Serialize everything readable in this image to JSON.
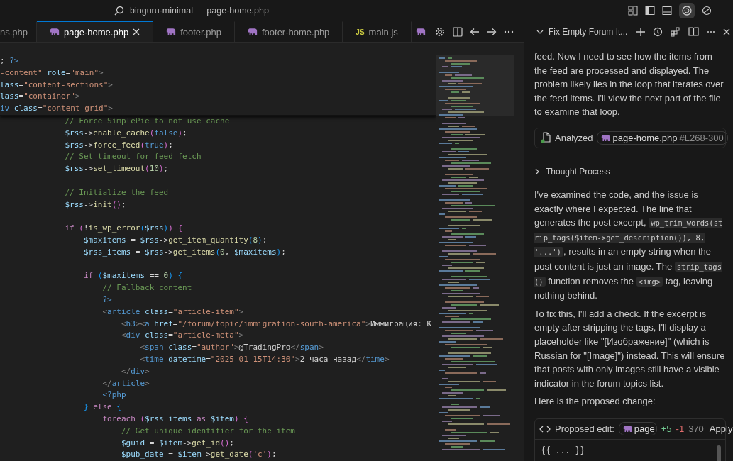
{
  "title_bar": {
    "title": "binguru-minimal — page-home.php"
  },
  "editor": {
    "tabs": [
      {
        "label": "ns.php",
        "selected": false,
        "kind": "cut"
      },
      {
        "label": "page-home.php",
        "selected": true,
        "kind": "php"
      },
      {
        "label": "footer.php",
        "selected": false,
        "kind": "php"
      },
      {
        "label": "footer-home.php",
        "selected": false,
        "kind": "php"
      },
      {
        "label": "main.js",
        "selected": false,
        "kind": "js",
        "badge": "JS"
      },
      {
        "selected": false,
        "kind": "php"
      }
    ],
    "sticky_lines": [
      {
        "kind": "code",
        "tokens": [
          {
            "text": "; ",
            "kind": "p"
          },
          {
            "text": "?>",
            "kind": "x"
          }
        ]
      },
      {
        "kind": "code",
        "tokens": [
          {
            "text": "-content\"",
            "kind": "s"
          },
          {
            "text": " role",
            "kind": "a"
          },
          {
            "text": "=",
            "kind": "p"
          },
          {
            "text": "\"main\"",
            "kind": "s"
          },
          {
            "text": ">",
            "kind": "g"
          }
        ]
      },
      {
        "kind": "code",
        "tokens": [
          {
            "text": "lass",
            "kind": "a"
          },
          {
            "text": "=",
            "kind": "p"
          },
          {
            "text": "\"content-sections\"",
            "kind": "s"
          },
          {
            "text": ">",
            "kind": "g"
          }
        ]
      },
      {
        "kind": "code",
        "tokens": [
          {
            "text": "lass",
            "kind": "a"
          },
          {
            "text": "=",
            "kind": "p"
          },
          {
            "text": "\"container\"",
            "kind": "s"
          },
          {
            "text": ">",
            "kind": "g"
          }
        ]
      },
      {
        "kind": "code",
        "tokens": [
          {
            "text": "iv",
            "kind": "t"
          },
          {
            "text": " class",
            "kind": "a"
          },
          {
            "text": "=",
            "kind": "p"
          },
          {
            "text": "\"content-grid\"",
            "kind": "s"
          },
          {
            "text": ">",
            "kind": "g"
          }
        ]
      }
    ],
    "lines": [
      {
        "kind": "code",
        "tokens": [
          {
            "text": "            // Force SimplePie to not use cache",
            "kind": "c"
          }
        ]
      },
      {
        "kind": "code",
        "tokens": [
          {
            "text": "            $rss",
            "kind": "v"
          },
          {
            "text": "->",
            "kind": "p"
          },
          {
            "text": "enable_cache",
            "kind": "f"
          },
          {
            "text": "(",
            "kind": "y"
          },
          {
            "text": "false",
            "kind": "l"
          },
          {
            "text": ")",
            "kind": "y"
          },
          {
            "text": ";",
            "kind": "p"
          }
        ]
      },
      {
        "kind": "code",
        "tokens": [
          {
            "text": "            $rss",
            "kind": "v"
          },
          {
            "text": "->",
            "kind": "p"
          },
          {
            "text": "force_feed",
            "kind": "f"
          },
          {
            "text": "(",
            "kind": "y"
          },
          {
            "text": "true",
            "kind": "l"
          },
          {
            "text": ")",
            "kind": "y"
          },
          {
            "text": ";",
            "kind": "p"
          }
        ]
      },
      {
        "kind": "code",
        "tokens": [
          {
            "text": "            // Set timeout for feed fetch",
            "kind": "c"
          }
        ]
      },
      {
        "kind": "code",
        "tokens": [
          {
            "text": "            $rss",
            "kind": "v"
          },
          {
            "text": "->",
            "kind": "p"
          },
          {
            "text": "set_timeout",
            "kind": "f"
          },
          {
            "text": "(",
            "kind": "y"
          },
          {
            "text": "10",
            "kind": "n"
          },
          {
            "text": ")",
            "kind": "y"
          },
          {
            "text": ";",
            "kind": "p"
          }
        ]
      },
      {
        "kind": "blank"
      },
      {
        "kind": "code",
        "tokens": [
          {
            "text": "            // Initialize the feed",
            "kind": "c"
          }
        ]
      },
      {
        "kind": "code",
        "tokens": [
          {
            "text": "            $rss",
            "kind": "v"
          },
          {
            "text": "->",
            "kind": "p"
          },
          {
            "text": "init",
            "kind": "f"
          },
          {
            "text": "()",
            "kind": "y"
          },
          {
            "text": ";",
            "kind": "p"
          }
        ]
      },
      {
        "kind": "blank"
      },
      {
        "kind": "code",
        "tokens": [
          {
            "text": "            if",
            "kind": "k"
          },
          {
            "text": " (",
            "kind": "y"
          },
          {
            "text": "!",
            "kind": "p"
          },
          {
            "text": "is_wp_error",
            "kind": "f"
          },
          {
            "text": "(",
            "kind": "u"
          },
          {
            "text": "$rss",
            "kind": "v"
          },
          {
            "text": ")",
            "kind": "u"
          },
          {
            "text": ")",
            "kind": "y"
          },
          {
            "text": " {",
            "kind": "y"
          }
        ]
      },
      {
        "kind": "code",
        "tokens": [
          {
            "text": "                $maxitems",
            "kind": "v"
          },
          {
            "text": " = ",
            "kind": "p"
          },
          {
            "text": "$rss",
            "kind": "v"
          },
          {
            "text": "->",
            "kind": "p"
          },
          {
            "text": "get_item_quantity",
            "kind": "f"
          },
          {
            "text": "(",
            "kind": "u"
          },
          {
            "text": "8",
            "kind": "n"
          },
          {
            "text": ")",
            "kind": "u"
          },
          {
            "text": ";",
            "kind": "p"
          }
        ]
      },
      {
        "kind": "code",
        "tokens": [
          {
            "text": "                $rss_items",
            "kind": "v"
          },
          {
            "text": " = ",
            "kind": "p"
          },
          {
            "text": "$rss",
            "kind": "v"
          },
          {
            "text": "->",
            "kind": "p"
          },
          {
            "text": "get_items",
            "kind": "f"
          },
          {
            "text": "(",
            "kind": "u"
          },
          {
            "text": "0",
            "kind": "n"
          },
          {
            "text": ", ",
            "kind": "p"
          },
          {
            "text": "$maxitems",
            "kind": "v"
          },
          {
            "text": ")",
            "kind": "u"
          },
          {
            "text": ";",
            "kind": "p"
          }
        ]
      },
      {
        "kind": "blank"
      },
      {
        "kind": "code",
        "tokens": [
          {
            "text": "                if",
            "kind": "k"
          },
          {
            "text": " (",
            "kind": "u"
          },
          {
            "text": "$maxitems",
            "kind": "v"
          },
          {
            "text": " == ",
            "kind": "p"
          },
          {
            "text": "0",
            "kind": "n"
          },
          {
            "text": ")",
            "kind": "u"
          },
          {
            "text": " {",
            "kind": "u"
          }
        ]
      },
      {
        "kind": "code",
        "tokens": [
          {
            "text": "                    // Fallback content",
            "kind": "c"
          }
        ]
      },
      {
        "kind": "code",
        "tokens": [
          {
            "text": "                    ?>",
            "kind": "x"
          }
        ]
      },
      {
        "kind": "code",
        "tokens": [
          {
            "text": "                    <",
            "kind": "g"
          },
          {
            "text": "article",
            "kind": "t"
          },
          {
            "text": " class",
            "kind": "a"
          },
          {
            "text": "=",
            "kind": "p"
          },
          {
            "text": "\"article-item\"",
            "kind": "s"
          },
          {
            "text": ">",
            "kind": "g"
          }
        ]
      },
      {
        "kind": "code",
        "tokens": [
          {
            "text": "                        <",
            "kind": "g"
          },
          {
            "text": "h3",
            "kind": "t"
          },
          {
            "text": "><",
            "kind": "g"
          },
          {
            "text": "a",
            "kind": "t"
          },
          {
            "text": " href",
            "kind": "a"
          },
          {
            "text": "=",
            "kind": "p"
          },
          {
            "text": "\"/forum/topic/immigration-south-america\"",
            "kind": "s"
          },
          {
            "text": ">",
            "kind": "g"
          },
          {
            "text": "Иммиграция: К",
            "kind": "p"
          }
        ]
      },
      {
        "kind": "code",
        "tokens": [
          {
            "text": "                        <",
            "kind": "g"
          },
          {
            "text": "div",
            "kind": "t"
          },
          {
            "text": " class",
            "kind": "a"
          },
          {
            "text": "=",
            "kind": "p"
          },
          {
            "text": "\"article-meta\"",
            "kind": "s"
          },
          {
            "text": ">",
            "kind": "g"
          }
        ]
      },
      {
        "kind": "code",
        "tokens": [
          {
            "text": "                            <",
            "kind": "g"
          },
          {
            "text": "span",
            "kind": "t"
          },
          {
            "text": " class",
            "kind": "a"
          },
          {
            "text": "=",
            "kind": "p"
          },
          {
            "text": "\"author\"",
            "kind": "s"
          },
          {
            "text": ">",
            "kind": "g"
          },
          {
            "text": "@TradingPro",
            "kind": "p"
          },
          {
            "text": "</",
            "kind": "g"
          },
          {
            "text": "span",
            "kind": "t"
          },
          {
            "text": ">",
            "kind": "g"
          }
        ]
      },
      {
        "kind": "code",
        "tokens": [
          {
            "text": "                            <",
            "kind": "g"
          },
          {
            "text": "time",
            "kind": "t"
          },
          {
            "text": " datetime",
            "kind": "a"
          },
          {
            "text": "=",
            "kind": "p"
          },
          {
            "text": "\"2025-01-15T14:30\"",
            "kind": "s"
          },
          {
            "text": ">",
            "kind": "g"
          },
          {
            "text": "2 часа назад",
            "kind": "p"
          },
          {
            "text": "</",
            "kind": "g"
          },
          {
            "text": "time",
            "kind": "t"
          },
          {
            "text": ">",
            "kind": "g"
          }
        ]
      },
      {
        "kind": "code",
        "tokens": [
          {
            "text": "                        </",
            "kind": "g"
          },
          {
            "text": "div",
            "kind": "t"
          },
          {
            "text": ">",
            "kind": "g"
          }
        ]
      },
      {
        "kind": "code",
        "tokens": [
          {
            "text": "                    </",
            "kind": "g"
          },
          {
            "text": "article",
            "kind": "t"
          },
          {
            "text": ">",
            "kind": "g"
          }
        ]
      },
      {
        "kind": "code",
        "tokens": [
          {
            "text": "                    <?php",
            "kind": "x"
          }
        ]
      },
      {
        "kind": "code",
        "tokens": [
          {
            "text": "                }",
            "kind": "u"
          },
          {
            "text": " else",
            "kind": "k"
          },
          {
            "text": " {",
            "kind": "u"
          }
        ]
      },
      {
        "kind": "code",
        "tokens": [
          {
            "text": "                    foreach",
            "kind": "k"
          },
          {
            "text": " (",
            "kind": "y"
          },
          {
            "text": "$rss_items",
            "kind": "v"
          },
          {
            "text": " as",
            "kind": "k"
          },
          {
            "text": " $item",
            "kind": "v"
          },
          {
            "text": ")",
            "kind": "y"
          },
          {
            "text": " {",
            "kind": "y"
          }
        ]
      },
      {
        "kind": "code",
        "tokens": [
          {
            "text": "                        // Get unique identifier for the item",
            "kind": "c"
          }
        ]
      },
      {
        "kind": "code",
        "tokens": [
          {
            "text": "                        $guid",
            "kind": "v"
          },
          {
            "text": " = ",
            "kind": "p"
          },
          {
            "text": "$item",
            "kind": "v"
          },
          {
            "text": "->",
            "kind": "p"
          },
          {
            "text": "get_id",
            "kind": "f"
          },
          {
            "text": "()",
            "kind": "y"
          },
          {
            "text": ";",
            "kind": "p"
          }
        ]
      },
      {
        "kind": "code",
        "tokens": [
          {
            "text": "                        $pub_date",
            "kind": "v"
          },
          {
            "text": " = ",
            "kind": "p"
          },
          {
            "text": "$item",
            "kind": "v"
          },
          {
            "text": "->",
            "kind": "p"
          },
          {
            "text": "get_date",
            "kind": "f"
          },
          {
            "text": "(",
            "kind": "y"
          },
          {
            "text": "'c'",
            "kind": "s"
          },
          {
            "text": ")",
            "kind": "y"
          },
          {
            "text": ";",
            "kind": "p"
          }
        ]
      }
    ]
  },
  "chat": {
    "title": "Fix Empty Forum It...",
    "blocks": [
      {
        "kind": "paragraph",
        "segments": [
          {
            "text": "feed. Now I need to see how the items from the feed are processed and displayed. The problem likely lies in the loop that iterates over the feed items. I'll view the next part of the file to examine that loop.",
            "kind": "text"
          }
        ]
      },
      {
        "kind": "tool",
        "label": "Analyzed",
        "file": "page-home.php",
        "range": "#L268-300"
      },
      {
        "kind": "disclosure",
        "label": "Thought Process",
        "expanded": false
      },
      {
        "kind": "paragraph",
        "segments": [
          {
            "text": "I've examined the code, and the issue is exactly where I expected. The line that generates the post excerpt, ",
            "kind": "text"
          },
          {
            "text": "wp_trim_words(strip_tags($item->get_description()), 8, '...')",
            "kind": "code"
          },
          {
            "text": ", results in an empty string when the post content is just an image. The ",
            "kind": "text"
          },
          {
            "text": "strip_tags()",
            "kind": "code"
          },
          {
            "text": " function removes the ",
            "kind": "text"
          },
          {
            "text": "<img>",
            "kind": "code"
          },
          {
            "text": " tag, leaving nothing behind.",
            "kind": "text"
          }
        ]
      },
      {
        "kind": "paragraph",
        "segments": [
          {
            "text": "To fix this, I'll add a check. If the excerpt is empty after stripping the tags, I'll display a placeholder like \"[Изображение]\" (which is Russian for \"[Image]\") instead. This will ensure that posts with only images still have a visible indicator in the forum topics list.",
            "kind": "text"
          }
        ]
      },
      {
        "kind": "paragraph",
        "segments": [
          {
            "text": "Here is the proposed change:",
            "kind": "text"
          }
        ]
      },
      {
        "kind": "edit",
        "label": "Proposed edit:",
        "file": "page",
        "added": "+5",
        "removed": "-1",
        "count": "370",
        "action": "Apply",
        "body": "{{ ... }}"
      }
    ]
  }
}
